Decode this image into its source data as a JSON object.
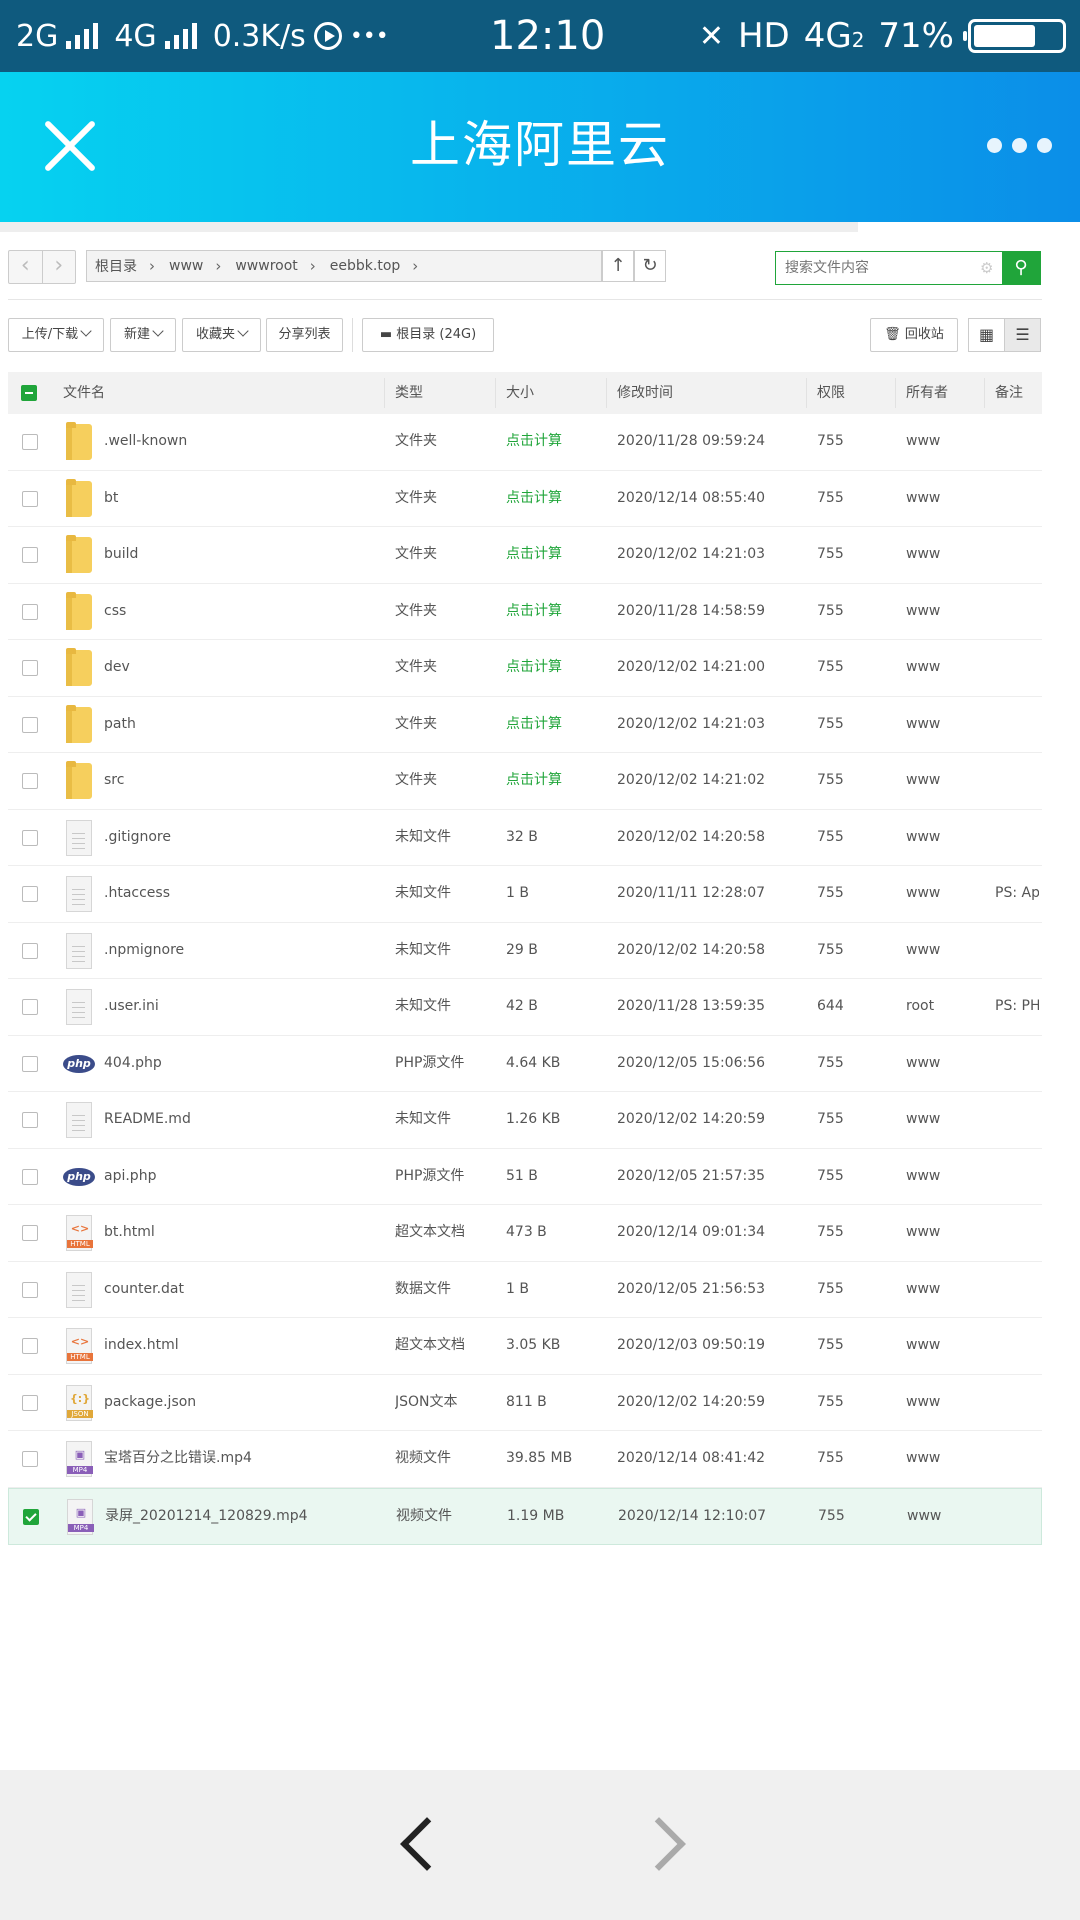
{
  "status_bar": {
    "sim1": "2G",
    "sim2": "4G",
    "speed": "0.3K/s",
    "dots": "•••",
    "time": "12:10",
    "network": "HD",
    "net_type": "4G",
    "net_sub": "2",
    "battery": "71%",
    "battery_level": 0.71
  },
  "header": {
    "title": "上海阿里云"
  },
  "breadcrumb": [
    "根目录",
    "www",
    "wwwroot",
    "eebbk.top"
  ],
  "search": {
    "placeholder": "搜索文件内容"
  },
  "toolbar": {
    "upload": "上传/下载",
    "new": "新建",
    "favorites": "收藏夹",
    "share_list": "分享列表",
    "disk": "根目录 (24G)",
    "recycle": "回收站"
  },
  "columns": {
    "name": "文件名",
    "type": "类型",
    "size": "大小",
    "mtime": "修改时间",
    "perm": "权限",
    "owner": "所有者",
    "note": "备注"
  },
  "files": [
    {
      "name": ".well-known",
      "icon": "folder",
      "type": "文件夹",
      "size": "点击计算",
      "mtime": "2020/11/28 09:59:24",
      "perm": "755",
      "owner": "www",
      "note": ""
    },
    {
      "name": "bt",
      "icon": "folder",
      "type": "文件夹",
      "size": "点击计算",
      "mtime": "2020/12/14 08:55:40",
      "perm": "755",
      "owner": "www",
      "note": ""
    },
    {
      "name": "build",
      "icon": "folder",
      "type": "文件夹",
      "size": "点击计算",
      "mtime": "2020/12/02 14:21:03",
      "perm": "755",
      "owner": "www",
      "note": ""
    },
    {
      "name": "css",
      "icon": "folder",
      "type": "文件夹",
      "size": "点击计算",
      "mtime": "2020/11/28 14:58:59",
      "perm": "755",
      "owner": "www",
      "note": ""
    },
    {
      "name": "dev",
      "icon": "folder",
      "type": "文件夹",
      "size": "点击计算",
      "mtime": "2020/12/02 14:21:00",
      "perm": "755",
      "owner": "www",
      "note": ""
    },
    {
      "name": "path",
      "icon": "folder",
      "type": "文件夹",
      "size": "点击计算",
      "mtime": "2020/12/02 14:21:03",
      "perm": "755",
      "owner": "www",
      "note": ""
    },
    {
      "name": "src",
      "icon": "folder",
      "type": "文件夹",
      "size": "点击计算",
      "mtime": "2020/12/02 14:21:02",
      "perm": "755",
      "owner": "www",
      "note": ""
    },
    {
      "name": ".gitignore",
      "icon": "file",
      "type": "未知文件",
      "size": "32 B",
      "mtime": "2020/12/02 14:20:58",
      "perm": "755",
      "owner": "www",
      "note": ""
    },
    {
      "name": ".htaccess",
      "icon": "file",
      "type": "未知文件",
      "size": "1 B",
      "mtime": "2020/11/11 12:28:07",
      "perm": "755",
      "owner": "www",
      "note": "PS: Apa"
    },
    {
      "name": ".npmignore",
      "icon": "file",
      "type": "未知文件",
      "size": "29 B",
      "mtime": "2020/12/02 14:20:58",
      "perm": "755",
      "owner": "www",
      "note": ""
    },
    {
      "name": ".user.ini",
      "icon": "file",
      "type": "未知文件",
      "size": "42 B",
      "mtime": "2020/11/28 13:59:35",
      "perm": "644",
      "owner": "root",
      "note": "PS: PHI"
    },
    {
      "name": "404.php",
      "icon": "php",
      "type": "PHP源文件",
      "size": "4.64 KB",
      "mtime": "2020/12/05 15:06:56",
      "perm": "755",
      "owner": "www",
      "note": ""
    },
    {
      "name": "README.md",
      "icon": "file",
      "type": "未知文件",
      "size": "1.26 KB",
      "mtime": "2020/12/02 14:20:59",
      "perm": "755",
      "owner": "www",
      "note": ""
    },
    {
      "name": "api.php",
      "icon": "php",
      "type": "PHP源文件",
      "size": "51 B",
      "mtime": "2020/12/05 21:57:35",
      "perm": "755",
      "owner": "www",
      "note": ""
    },
    {
      "name": "bt.html",
      "icon": "html",
      "type": "超文本文档",
      "size": "473 B",
      "mtime": "2020/12/14 09:01:34",
      "perm": "755",
      "owner": "www",
      "note": ""
    },
    {
      "name": "counter.dat",
      "icon": "file",
      "type": "数据文件",
      "size": "1 B",
      "mtime": "2020/12/05 21:56:53",
      "perm": "755",
      "owner": "www",
      "note": ""
    },
    {
      "name": "index.html",
      "icon": "html",
      "type": "超文本文档",
      "size": "3.05 KB",
      "mtime": "2020/12/03 09:50:19",
      "perm": "755",
      "owner": "www",
      "note": ""
    },
    {
      "name": "package.json",
      "icon": "json",
      "type": "JSON文本",
      "size": "811 B",
      "mtime": "2020/12/02 14:20:59",
      "perm": "755",
      "owner": "www",
      "note": ""
    },
    {
      "name": "宝塔百分之比错误.mp4",
      "icon": "mp4",
      "type": "视频文件",
      "size": "39.85 MB",
      "mtime": "2020/12/14 08:41:42",
      "perm": "755",
      "owner": "www",
      "note": ""
    },
    {
      "name": "录屏_20201214_120829.mp4",
      "icon": "mp4",
      "type": "视频文件",
      "size": "1.19 MB",
      "mtime": "2020/12/14 12:10:07",
      "perm": "755",
      "owner": "www",
      "note": "",
      "selected": true
    }
  ],
  "colors": {
    "accent": "#20a53a",
    "header_start": "#06d2f0",
    "header_end": "#0b8ee8",
    "status_bar": "#0f5a7e"
  }
}
